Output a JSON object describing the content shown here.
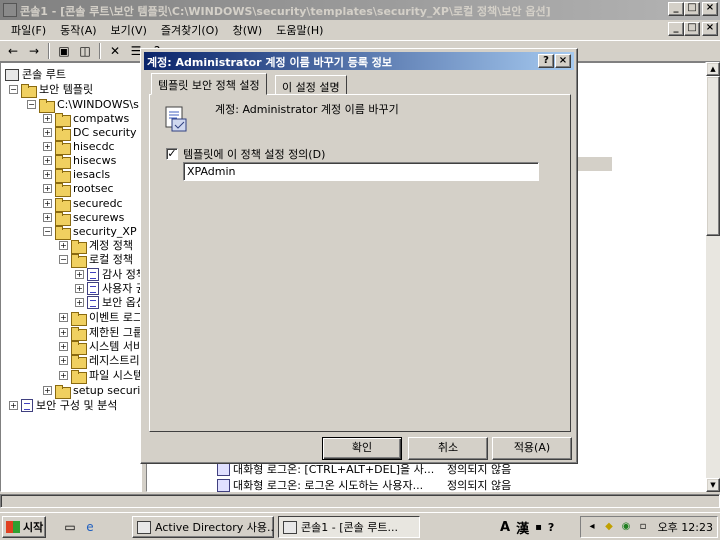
{
  "main_window": {
    "title": "콘솔1 - [콘솔 루트\\보안 템플릿\\C:\\WINDOWS\\security\\templates\\security_XP\\로컬 정책\\보안 옵션]",
    "caption_buttons": [
      "_",
      "□",
      "×"
    ],
    "inner_caption_buttons": [
      "_",
      "□",
      "×"
    ]
  },
  "menu": [
    "파일(F)",
    "동작(A)",
    "보기(V)",
    "즐겨찾기(O)",
    "창(W)",
    "도움말(H)"
  ],
  "toolbar_icons": [
    "back-icon",
    "forward-icon",
    "up-folder-icon",
    "show-hide-tree-icon",
    "delete-icon",
    "properties-icon",
    "help-icon"
  ],
  "tree": {
    "root": "콘솔 루트",
    "security_templates": "보안 템플릿",
    "path": "C:\\WINDOWS\\s",
    "templates": [
      "compatws",
      "DC security",
      "hisecdc",
      "hisecws",
      "iesacls",
      "rootsec",
      "securedc",
      "securews",
      "security_XP"
    ],
    "security_xp_children": [
      "계정 정책",
      "로컬 정책",
      "이벤트 로그",
      "제한된 그룹",
      "시스템 서비스",
      "레지스트리",
      "파일 시스템"
    ],
    "local_policy_children": [
      "감사 정책",
      "사용자 권한",
      "보안 옵션"
    ],
    "setup_security": "setup securit",
    "analysis": "보안 구성 및 분석"
  },
  "right_pane": {
    "rows": [
      {
        "name": "대화형 로그온: [CTRL+ALT+DEL]을 사...",
        "value": "정의되지 않음"
      },
      {
        "name": "대화형 로그온: 로그온 시도하는 사용자...",
        "value": "정의되지 않음"
      }
    ]
  },
  "dialog": {
    "title": "계정: Administrator 계정 이름 바꾸기 등록 정보",
    "help_button": "?",
    "close_button": "×",
    "tabs": [
      "템플릿 보안 정책 설정",
      "이 설정 설명"
    ],
    "description": "계정: Administrator 계정 이름 바꾸기",
    "define_checkbox_label": "템플릿에 이 정책 설정 정의(D)",
    "define_checked": true,
    "check_mark": "✓",
    "name_value": "XPAdmin",
    "buttons": {
      "ok": "확인",
      "cancel": "취소",
      "apply": "적용(A)"
    }
  },
  "taskbar": {
    "start": "시작",
    "tasks": [
      "Active Directory 사용...",
      "콘솔1 - [콘솔 루트..."
    ],
    "ime_label": "A",
    "ime_hanja": "漢",
    "clock": "오후 12:23"
  }
}
